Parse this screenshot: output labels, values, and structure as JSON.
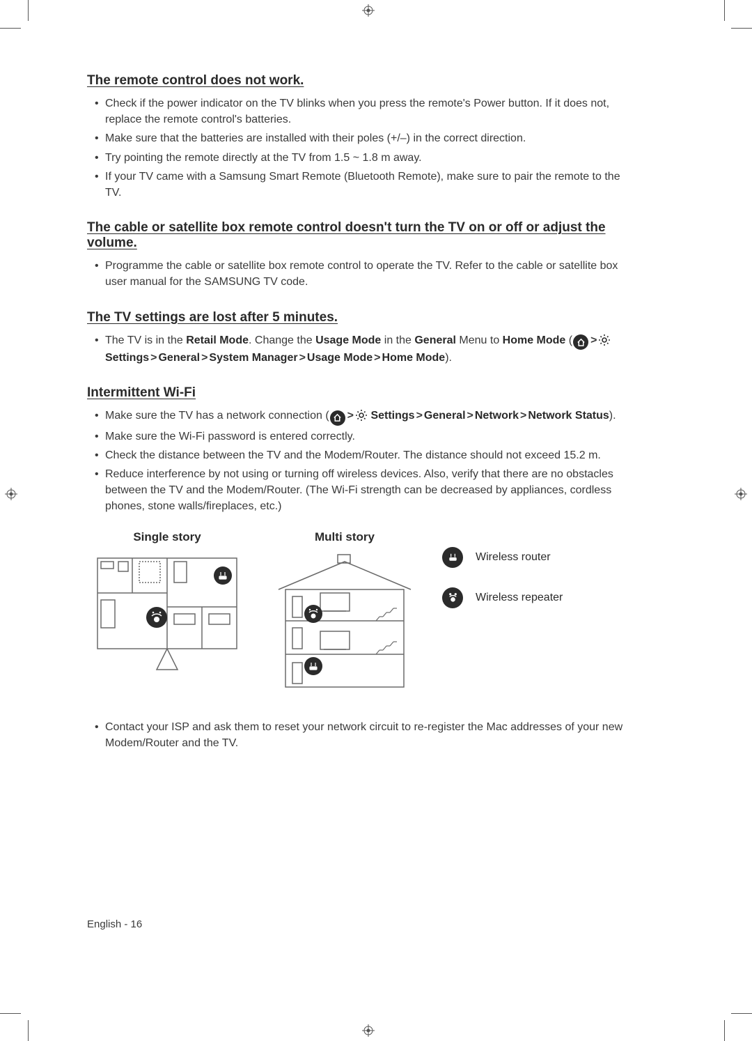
{
  "sections": [
    {
      "title": "The remote control does not work.",
      "items": [
        "Check if the power indicator on the TV blinks when you press the remote's Power button. If it does not, replace the remote control's batteries.",
        "Make sure that the batteries are installed with their poles (+/–) in the correct direction.",
        "Try pointing the remote directly at the TV from 1.5 ~ 1.8 m away.",
        "If your TV came with a Samsung Smart Remote (Bluetooth Remote), make sure to pair the remote to the TV."
      ]
    },
    {
      "title": "The cable or satellite box remote control doesn't turn the TV on or off or adjust the volume.",
      "items": [
        "Programme the cable or satellite box remote control to operate the TV. Refer to the cable or satellite box user manual for the SAMSUNG TV code."
      ]
    },
    {
      "title": "The TV settings are lost after 5 minutes.",
      "retail": {
        "pre": "The TV is in the ",
        "retail_mode": "Retail Mode",
        "mid1": ". Change the ",
        "usage_mode": "Usage Mode",
        "mid2": " in the ",
        "general": "General",
        "mid3": " Menu to ",
        "home_mode": "Home Mode",
        "open": " (",
        "settings": "Settings",
        "general2": "General",
        "system_manager": "System Manager",
        "usage_mode2": "Usage Mode",
        "home_mode2": "Home Mode",
        "close": ")."
      }
    },
    {
      "title": "Intermittent Wi-Fi",
      "wifi_path": {
        "pre": "Make sure the TV has a network connection (",
        "settings": "Settings",
        "general": "General",
        "network": "Network",
        "network_status": "Network Status",
        "close": ")."
      },
      "items_tail": [
        "Make sure the Wi-Fi password is entered correctly.",
        "Check the distance between the TV and the Modem/Router. The distance should not exceed 15.2 m.",
        "Reduce interference by not using or turning off wireless devices. Also, verify that there are no obstacles between the TV and the Modem/Router. (The Wi-Fi strength can be decreased by appliances, cordless phones, stone walls/fireplaces, etc.)"
      ],
      "diagram": {
        "single": "Single story",
        "multi": "Multi story",
        "legend_router": "Wireless router",
        "legend_repeater": "Wireless repeater"
      },
      "after_diagram": "Contact your ISP and ask them to reset your network circuit to re-register the Mac addresses of your new Modem/Router and the TV."
    }
  ],
  "footer": "English - 16"
}
